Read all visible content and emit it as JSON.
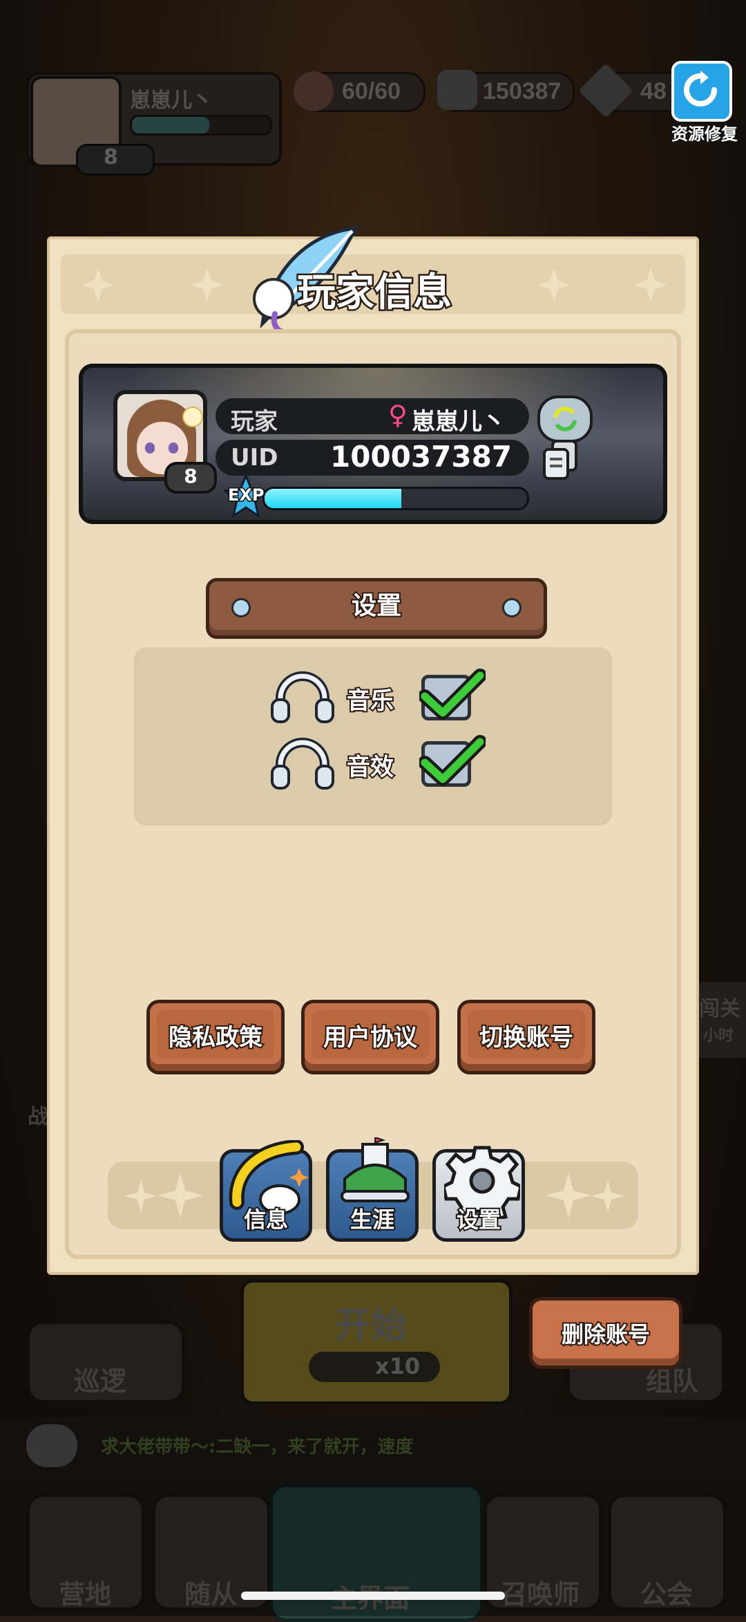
{
  "hud": {
    "player_name": "崽崽儿丶",
    "player_level": "8",
    "stamina": "60/60",
    "stone": "150387",
    "gems": "48",
    "repair_label": "资源修复"
  },
  "background": {
    "start_label": "开始",
    "start_cost": "x10",
    "patrol_label": "巡逻",
    "team_label": "组队",
    "chat_text": "求大佬带带～:二缺一，来了就开，速度",
    "nav": [
      "营地",
      "随从",
      "主界面",
      "召唤师",
      "公会"
    ],
    "side_left_1": "战",
    "side_right_1": "闯关",
    "side_right_2": "小时"
  },
  "dialog": {
    "title": "玩家信息",
    "profile": {
      "player_label": "玩家",
      "gender_symbol": "♀",
      "name": "崽崽儿丶",
      "uid_label": "UID",
      "uid_value": "100037387",
      "level": "8",
      "exp_label": "EXP",
      "exp_fraction": 0.52
    },
    "settings_header": "设置",
    "music_label": "音乐",
    "sfx_label": "音效",
    "music_enabled": true,
    "sfx_enabled": true,
    "buttons": {
      "privacy": "隐私政策",
      "agreement": "用户协议",
      "switch_account": "切换账号",
      "delete_account": "删除账号"
    },
    "tabs": [
      {
        "label": "信息"
      },
      {
        "label": "生涯"
      },
      {
        "label": "设置"
      }
    ]
  },
  "colors": {
    "dialog_bg": "#efe0c0",
    "button_brown": "#c4714a",
    "check_green": "#3ecb3a",
    "exp_cyan": "#1ed6f4"
  }
}
